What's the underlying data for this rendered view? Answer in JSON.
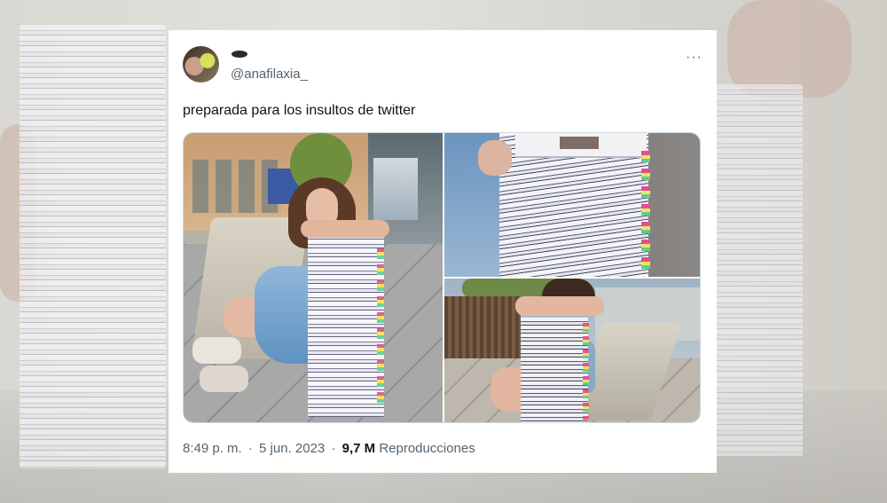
{
  "tweet": {
    "display_name": "",
    "handle": "@anafilaxia_",
    "more_icon": "···",
    "text": "preparada para los insultos de twitter",
    "time": "8:49 p. m.",
    "separator": "·",
    "date": "5 jun. 2023",
    "views_count": "9,7 M",
    "views_label": "Reproducciones"
  },
  "colors": {
    "text_primary": "#0f1419",
    "text_secondary": "#536471",
    "card_background": "#ffffff",
    "border": "#cfd9de"
  },
  "media": {
    "photo_count": 3
  }
}
